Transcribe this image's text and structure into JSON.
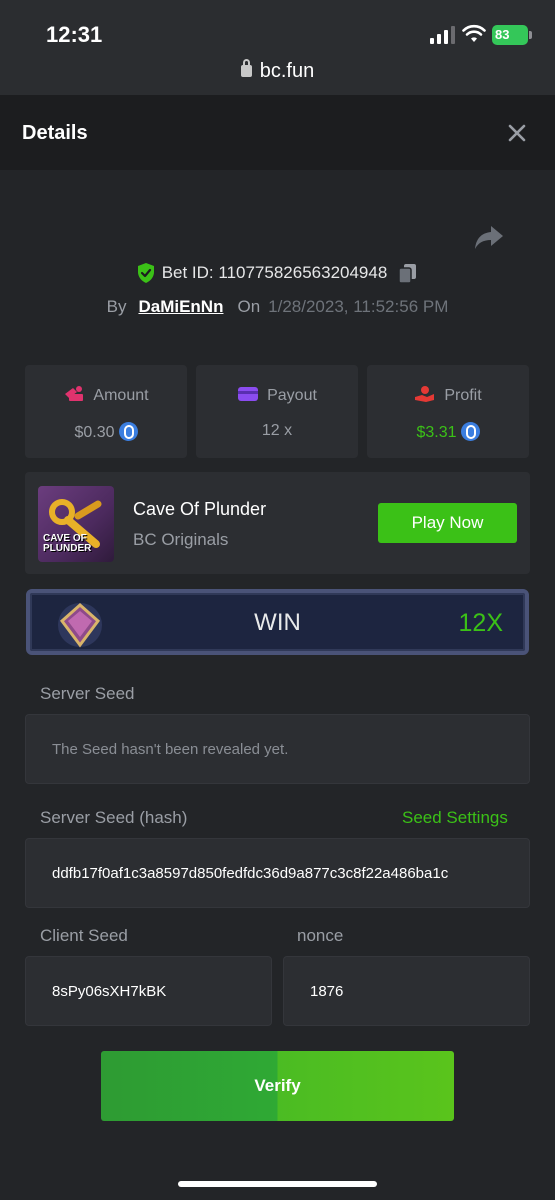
{
  "status_bar": {
    "time": "12:31",
    "battery": "83",
    "url": "bc.fun"
  },
  "header": {
    "title": "Details"
  },
  "bet": {
    "id_label": "Bet ID: 110775826563204948",
    "by_label": "By",
    "username": "DaMiEnNn",
    "on_label": "On",
    "datetime": "1/28/2023, 11:52:56 PM"
  },
  "stats": {
    "amount": {
      "label": "Amount",
      "value": "$0.30"
    },
    "payout": {
      "label": "Payout",
      "value": "12 x"
    },
    "profit": {
      "label": "Profit",
      "value": "$3.31"
    }
  },
  "game": {
    "thumb_text_1": "CAVE OF",
    "thumb_text_2": "PLUNDER",
    "name": "Cave Of Plunder",
    "provider": "BC Originals",
    "play_label": "Play Now"
  },
  "result": {
    "label": "WIN",
    "multiplier": "12X"
  },
  "server_seed": {
    "label": "Server Seed",
    "placeholder": "The Seed hasn't been revealed yet."
  },
  "server_seed_hash": {
    "label": "Server Seed (hash)",
    "settings_link": "Seed Settings",
    "value": "ddfb17f0af1c3a8597d850fedfdc36d9a877c3c8f22a486ba1c"
  },
  "client_seed": {
    "label": "Client Seed",
    "value": "8sPy06sXH7kBK"
  },
  "nonce": {
    "label": "nonce",
    "value": "1876"
  },
  "verify_label": "Verify",
  "colors": {
    "accent_green": "#3bc117",
    "profit_green": "#3bc117",
    "background": "#232528",
    "card": "#2c2e32"
  }
}
